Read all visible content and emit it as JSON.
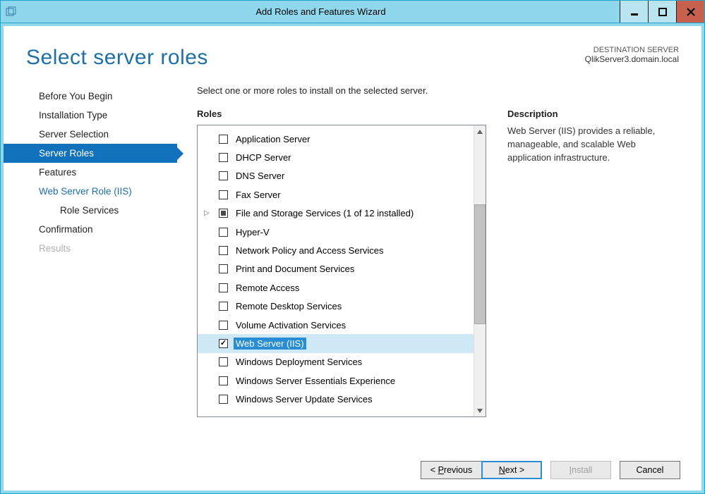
{
  "window": {
    "title": "Add Roles and Features Wizard"
  },
  "header": {
    "page_title": "Select server roles",
    "dest_label": "DESTINATION SERVER",
    "dest_server": "QlikServer3.domain.local"
  },
  "nav": {
    "items": [
      {
        "label": "Before You Begin",
        "state": "normal"
      },
      {
        "label": "Installation Type",
        "state": "normal"
      },
      {
        "label": "Server Selection",
        "state": "normal"
      },
      {
        "label": "Server Roles",
        "state": "selected"
      },
      {
        "label": "Features",
        "state": "normal"
      },
      {
        "label": "Web Server Role (IIS)",
        "state": "link"
      },
      {
        "label": "Role Services",
        "state": "normal",
        "indent": true
      },
      {
        "label": "Confirmation",
        "state": "normal"
      },
      {
        "label": "Results",
        "state": "disabled"
      }
    ]
  },
  "main": {
    "instruction": "Select one or more roles to install on the selected server.",
    "roles_header": "Roles",
    "roles": [
      {
        "label": "Application Server",
        "checked": false
      },
      {
        "label": "DHCP Server",
        "checked": false
      },
      {
        "label": "DNS Server",
        "checked": false
      },
      {
        "label": "Fax Server",
        "checked": false
      },
      {
        "label": "File and Storage Services (1 of 12 installed)",
        "checked": "partial",
        "expandable": true
      },
      {
        "label": "Hyper-V",
        "checked": false
      },
      {
        "label": "Network Policy and Access Services",
        "checked": false
      },
      {
        "label": "Print and Document Services",
        "checked": false
      },
      {
        "label": "Remote Access",
        "checked": false
      },
      {
        "label": "Remote Desktop Services",
        "checked": false
      },
      {
        "label": "Volume Activation Services",
        "checked": false
      },
      {
        "label": "Web Server (IIS)",
        "checked": true,
        "selected": true
      },
      {
        "label": "Windows Deployment Services",
        "checked": false
      },
      {
        "label": "Windows Server Essentials Experience",
        "checked": false
      },
      {
        "label": "Windows Server Update Services",
        "checked": false
      }
    ],
    "desc_header": "Description",
    "desc_text": "Web Server (IIS) provides a reliable, manageable, and scalable Web application infrastructure."
  },
  "footer": {
    "previous": "< Previous",
    "next": "Next >",
    "install": "Install",
    "cancel": "Cancel"
  }
}
